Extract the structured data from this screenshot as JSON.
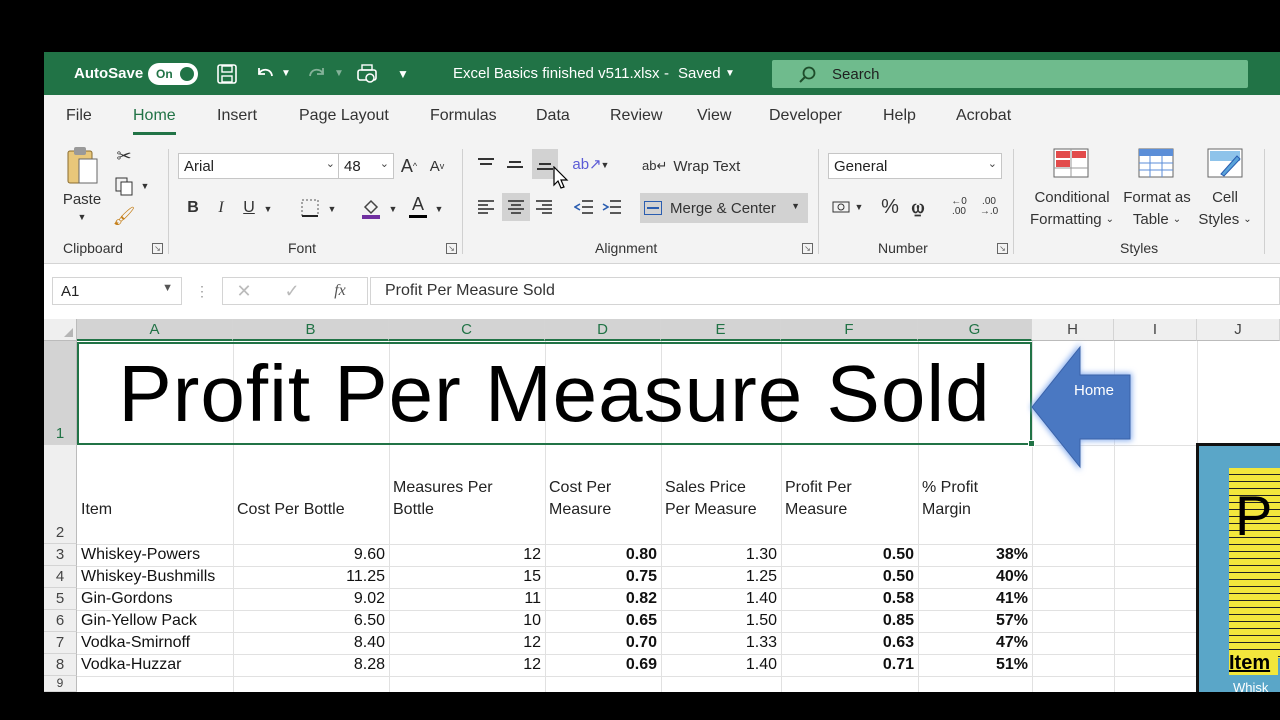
{
  "titlebar": {
    "autosave_label": "AutoSave",
    "toggle_label": "On",
    "doc_title": "Excel Basics finished v511.xlsx",
    "saved_status": "Saved",
    "search_placeholder": "Search"
  },
  "tabs": [
    "File",
    "Home",
    "Insert",
    "Page Layout",
    "Formulas",
    "Data",
    "Review",
    "View",
    "Developer",
    "Help",
    "Acrobat"
  ],
  "ribbon": {
    "clipboard": {
      "paste": "Paste",
      "label": "Clipboard"
    },
    "font": {
      "name": "Arial",
      "size": "48",
      "label": "Font",
      "bold": "B",
      "italic": "I",
      "underline": "U"
    },
    "alignment": {
      "wrap_text": "Wrap Text",
      "merge_center": "Merge & Center",
      "label": "Alignment"
    },
    "number": {
      "format": "General",
      "label": "Number"
    },
    "styles": {
      "conditional_1": "Conditional",
      "conditional_2": "Formatting",
      "format_table_1": "Format as",
      "format_table_2": "Table",
      "cell_styles_1": "Cell",
      "cell_styles_2": "Styles",
      "label": "Styles"
    }
  },
  "formula_bar": {
    "name_box": "A1",
    "fx": "fx",
    "content": "Profit Per Measure Sold"
  },
  "sheet": {
    "columns": [
      "A",
      "B",
      "C",
      "D",
      "E",
      "F",
      "G",
      "H",
      "I",
      "J"
    ],
    "rows": [
      "1",
      "2",
      "3",
      "4",
      "5",
      "6",
      "7",
      "8",
      "9"
    ],
    "title": "Profit Per Measure Sold",
    "headers": {
      "item": "Item",
      "cost_per_bottle": "Cost Per Bottle",
      "measures_per_bottle_1": "Measures Per",
      "measures_per_bottle_2": "Bottle",
      "cost_per_measure_1": "Cost Per",
      "cost_per_measure_2": "Measure",
      "sales_price_1": "Sales Price",
      "sales_price_2": "Per Measure",
      "profit_per_measure_1": "Profit Per",
      "profit_per_measure_2": "Measure",
      "profit_margin_1": "% Profit",
      "profit_margin_2": "Margin"
    },
    "data": [
      [
        "Whiskey-Powers",
        "9.60",
        "12",
        "0.80",
        "1.30",
        "0.50",
        "38%"
      ],
      [
        "Whiskey-Bushmills",
        "11.25",
        "15",
        "0.75",
        "1.25",
        "0.50",
        "40%"
      ],
      [
        "Gin-Gordons",
        "9.02",
        "11",
        "0.82",
        "1.40",
        "0.58",
        "41%"
      ],
      [
        "Gin-Yellow Pack",
        "6.50",
        "10",
        "0.65",
        "1.50",
        "0.85",
        "57%"
      ],
      [
        "Vodka-Smirnoff",
        "8.40",
        "12",
        "0.70",
        "1.33",
        "0.63",
        "47%"
      ],
      [
        "Vodka-Huzzar",
        "8.28",
        "12",
        "0.69",
        "1.40",
        "0.71",
        "51%"
      ]
    ]
  },
  "callout": {
    "label": "Home"
  },
  "thumbnail": {
    "letter": "P",
    "heading": "Item",
    "row": "Whisk"
  }
}
